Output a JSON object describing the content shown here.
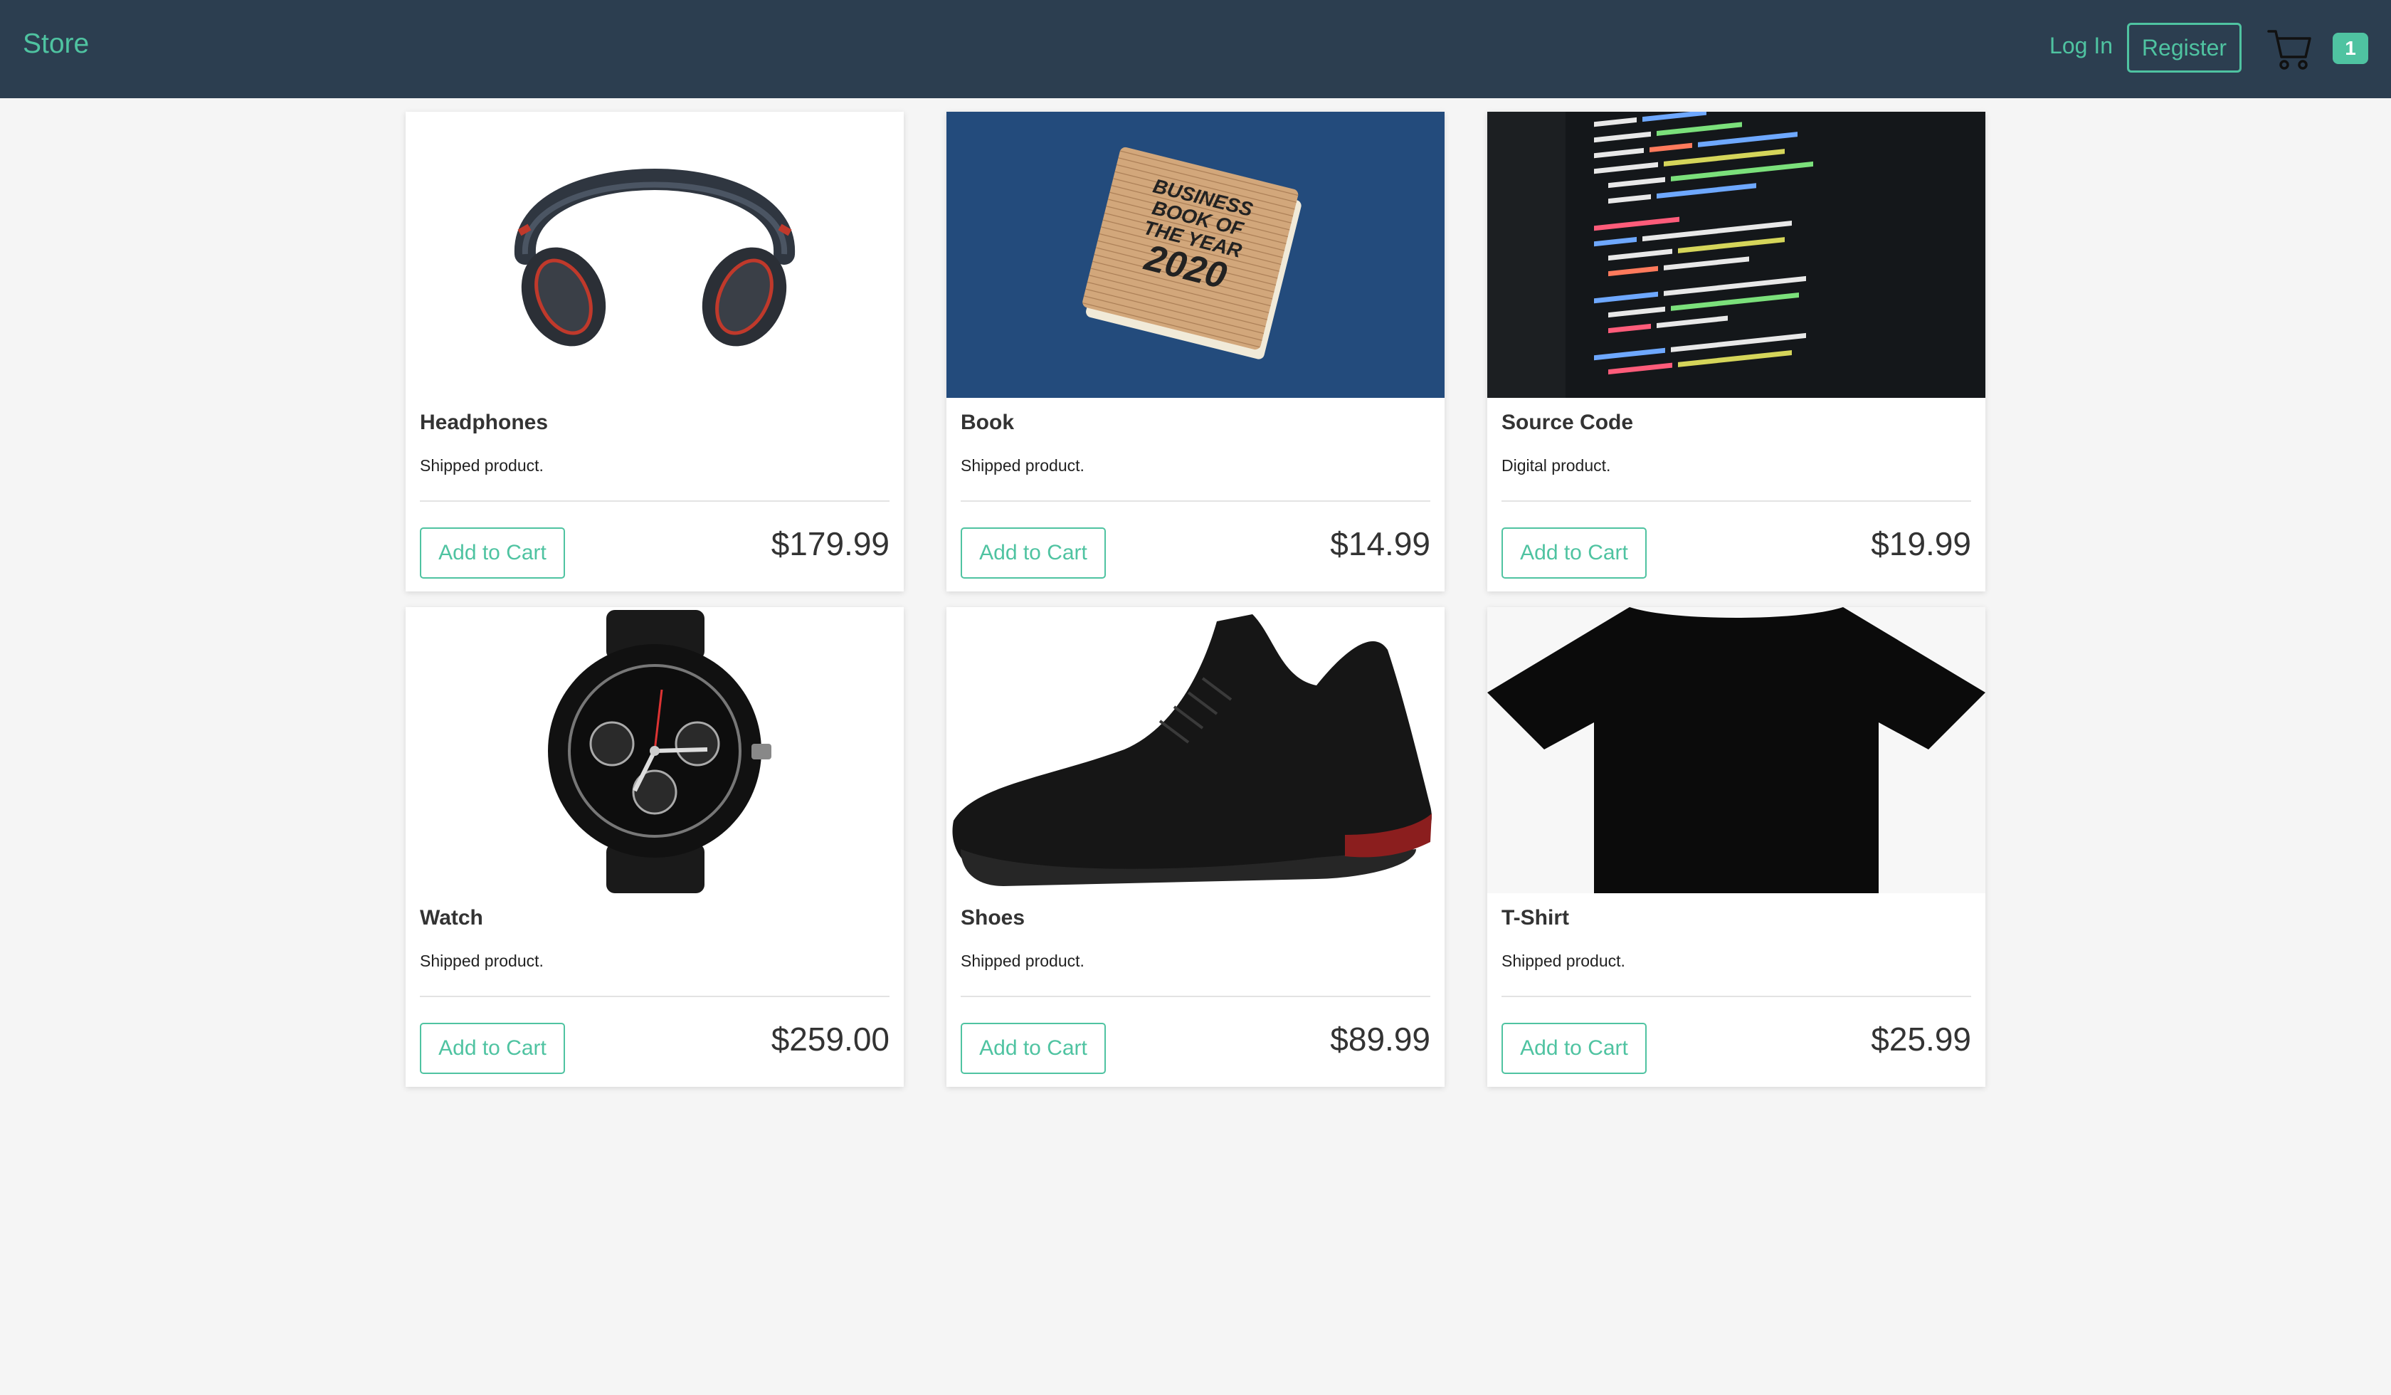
{
  "nav": {
    "brand": "Store",
    "login": "Log In",
    "register": "Register",
    "cart_count": "1",
    "accent": "#4fc3a1",
    "background": "#2c3e50"
  },
  "products": [
    {
      "name": "Headphones",
      "description": "Shipped product.",
      "price": "$179.99",
      "button": "Add to Cart",
      "image": "headphones"
    },
    {
      "name": "Book",
      "description": "Shipped product.",
      "price": "$14.99",
      "button": "Add to Cart",
      "image": "business-book-2020",
      "image_text": [
        "BUSINESS",
        "BOOK OF",
        "THE YEAR",
        "2020"
      ]
    },
    {
      "name": "Source Code",
      "description": "Digital product.",
      "price": "$19.99",
      "button": "Add to Cart",
      "image": "source-code-screen"
    },
    {
      "name": "Watch",
      "description": "Shipped product.",
      "price": "$259.00",
      "button": "Add to Cart",
      "image": "wrist-watch"
    },
    {
      "name": "Shoes",
      "description": "Shipped product.",
      "price": "$89.99",
      "button": "Add to Cart",
      "image": "sneaker"
    },
    {
      "name": "T-Shirt",
      "description": "Shipped product.",
      "price": "$25.99",
      "button": "Add to Cart",
      "image": "black-tshirt"
    }
  ]
}
